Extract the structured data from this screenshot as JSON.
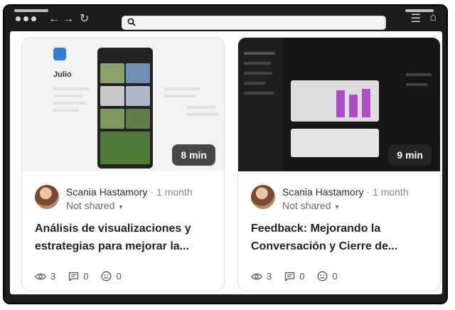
{
  "browser": {
    "nav_back": "←",
    "nav_forward": "→",
    "reload": "↻",
    "search_glyph": "⚲",
    "menu_glyph": "☰",
    "home_glyph": "⌂"
  },
  "cards": [
    {
      "duration": "8 min",
      "author": "Scania Hastamory",
      "separator": "·",
      "time": "1 month",
      "sharing": "Not shared",
      "title": "Análisis de visualizaciones y estrategias para mejorar la...",
      "views": "3",
      "comments": "0",
      "reactions": "0",
      "thumb_label": "Julio"
    },
    {
      "duration": "9 min",
      "author": "Scania Hastamory",
      "separator": "·",
      "time": "1 month",
      "sharing": "Not shared",
      "title": "Feedback: Mejorando la Conversación y Cierre de...",
      "views": "3",
      "comments": "0",
      "reactions": "0"
    }
  ]
}
